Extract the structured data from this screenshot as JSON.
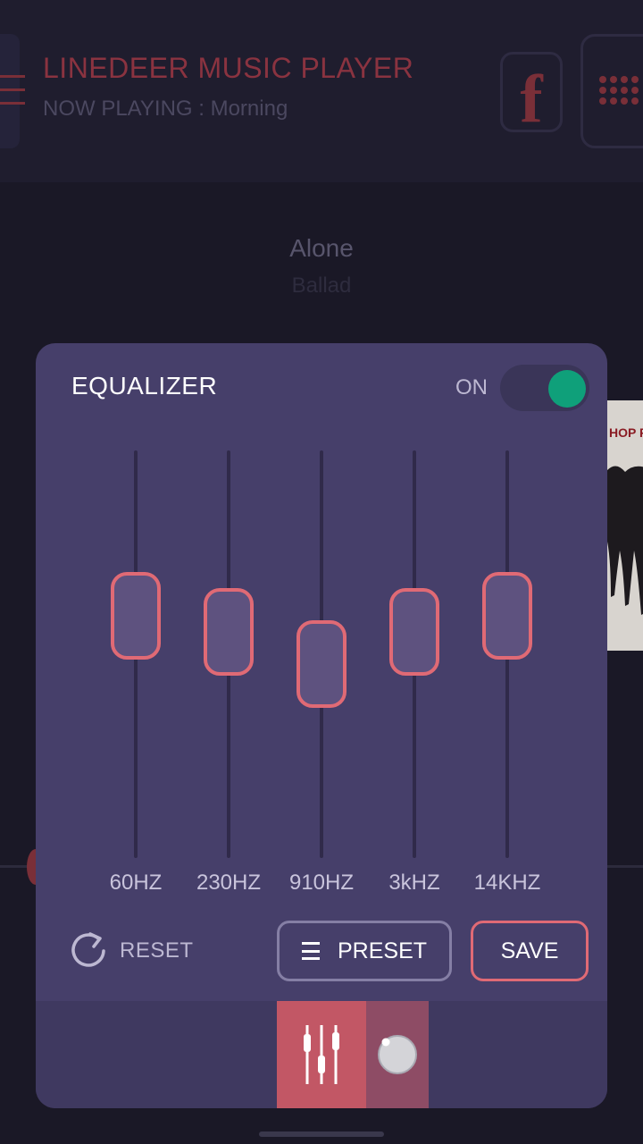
{
  "background": {
    "app_title": "LINEDEER MUSIC PLAYER",
    "now_playing": "NOW PLAYING : Morning",
    "song_title": "Alone",
    "song_genre": "Ballad",
    "album_text": "HOP FE"
  },
  "equalizer": {
    "title": "EQUALIZER",
    "power_label": "ON",
    "power_on": true,
    "bands": [
      {
        "label": "60HZ",
        "level": 0.62
      },
      {
        "label": "230HZ",
        "level": 0.57
      },
      {
        "label": "910HZ",
        "level": 0.47
      },
      {
        "label": "3kHZ",
        "level": 0.57
      },
      {
        "label": "14KHZ",
        "level": 0.62
      }
    ],
    "reset_label": "RESET",
    "preset_label": "PRESET",
    "save_label": "SAVE"
  },
  "icons": {
    "menu": "menu-icon",
    "facebook": "facebook-icon",
    "dialpad": "dialpad-icon",
    "reset": "refresh-icon",
    "preset": "list-icon",
    "equalizer_tab": "sliders-icon",
    "knob_tab": "knob-icon"
  },
  "colors": {
    "accent": "#e06a75",
    "toggle_on": "#0fa07a",
    "dialog_bg": "#463f6a"
  }
}
